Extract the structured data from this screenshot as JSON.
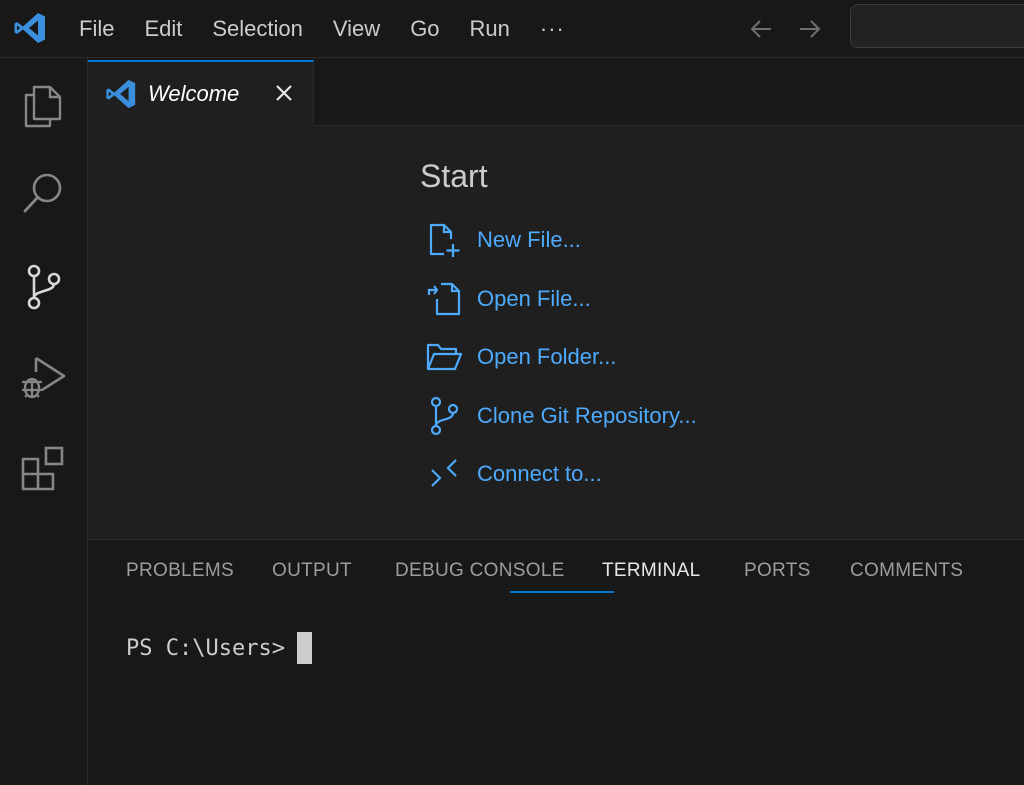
{
  "titlebar": {
    "menu": [
      "File",
      "Edit",
      "Selection",
      "View",
      "Go",
      "Run"
    ],
    "more_label": "···",
    "logo_icon": "vscode-logo-icon",
    "back_icon": "arrow-left-icon",
    "forward_icon": "arrow-right-icon"
  },
  "activitybar": {
    "items": [
      "explorer-icon",
      "search-icon",
      "source-control-icon",
      "run-debug-icon",
      "extensions-icon"
    ]
  },
  "tabs": [
    {
      "label": "Welcome",
      "active": true,
      "italic": true
    }
  ],
  "welcome": {
    "section_title": "Start",
    "actions": [
      {
        "label": "New File...",
        "icon": "new-file-icon"
      },
      {
        "label": "Open File...",
        "icon": "open-file-icon"
      },
      {
        "label": "Open Folder...",
        "icon": "open-folder-icon"
      },
      {
        "label": "Clone Git Repository...",
        "icon": "git-branch-icon"
      },
      {
        "label": "Connect to...",
        "icon": "remote-icon"
      }
    ]
  },
  "panel": {
    "tabs": [
      "PROBLEMS",
      "OUTPUT",
      "DEBUG CONSOLE",
      "TERMINAL",
      "PORTS",
      "COMMENTS"
    ],
    "active_tab": "TERMINAL",
    "terminal_prompt": "PS C:\\Users>"
  },
  "colors": {
    "accent": "#0078d4",
    "link": "#4daafc",
    "logo_blue": "#3c8fdc"
  }
}
